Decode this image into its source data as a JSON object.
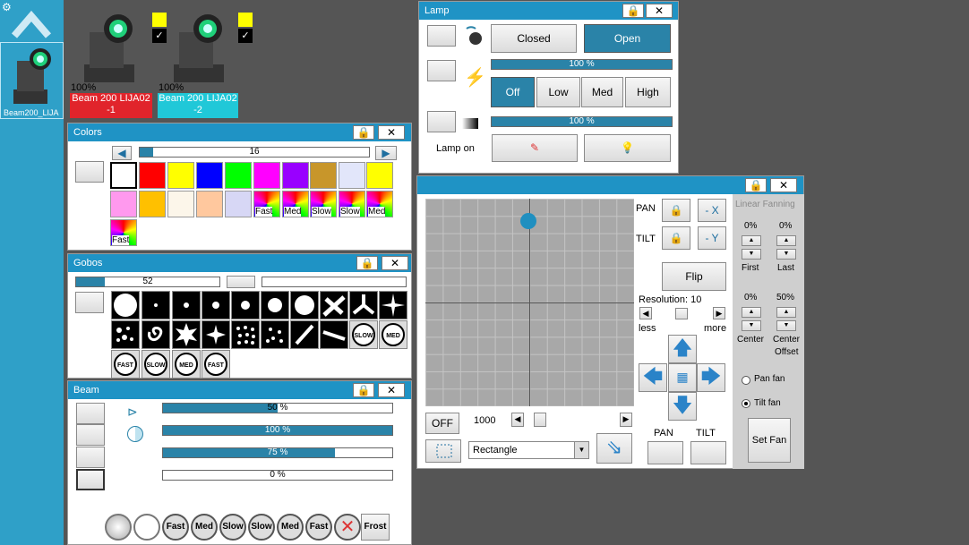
{
  "fixtures": [
    {
      "percent": "100%",
      "name_line1": "Beam 200 LIJA02",
      "name_line2": "-1",
      "label_color": "#e1242b"
    },
    {
      "percent": "100%",
      "name_line1": "Beam 200 LIJA02",
      "name_line2": "-2",
      "label_color": "#20c8d8"
    }
  ],
  "sidebar": {
    "fixture_label": "Beam200_LIJA"
  },
  "lamp": {
    "title": "Lamp",
    "closed": "Closed",
    "open": "Open",
    "intensity1": "100 %",
    "off": "Off",
    "low": "Low",
    "med": "Med",
    "high": "High",
    "intensity2": "100 %",
    "lamp_on": "Lamp on"
  },
  "colors": {
    "title": "Colors",
    "slider_value": "16",
    "fast": "Fast",
    "med": "Med",
    "slow": "Slow",
    "fx": [
      "Fast",
      "Med",
      "Slow",
      "Slow",
      "Med",
      "Fast"
    ]
  },
  "gobos": {
    "title": "Gobos",
    "slider_value": "52",
    "labels": [
      "SLOW",
      "MED",
      "FAST",
      "SLOW",
      "MED",
      "FAST"
    ]
  },
  "beam": {
    "title": "Beam",
    "bars": [
      "50 %",
      "100 %",
      "75 %",
      "0 %"
    ],
    "bar_levels": [
      0.5,
      1.0,
      0.75,
      0.0
    ],
    "bottom": [
      "Fast",
      "Med",
      "Slow",
      "Slow",
      "Med",
      "Fast",
      "Frost"
    ]
  },
  "pantilt": {
    "pan": "PAN",
    "tilt": "TILT",
    "minus_x": "- X",
    "minus_y": "- Y",
    "flip": "Flip",
    "resolution": "Resolution: 10",
    "less": "less",
    "more": "more",
    "off": "OFF",
    "speed": "1000",
    "shape": "Rectangle",
    "pan_bottom": "PAN",
    "tilt_bottom": "TILT"
  },
  "fanning": {
    "title": "Linear Fanning",
    "first_pct": "0%",
    "last_pct": "0%",
    "first": "First",
    "last": "Last",
    "center_pct": "0%",
    "offset_pct": "50%",
    "center": "Center",
    "center_offset_1": "Center",
    "center_offset_2": "Offset",
    "pan_fan": "Pan fan",
    "tilt_fan": "Tilt fan",
    "set_fan": "Set Fan"
  }
}
